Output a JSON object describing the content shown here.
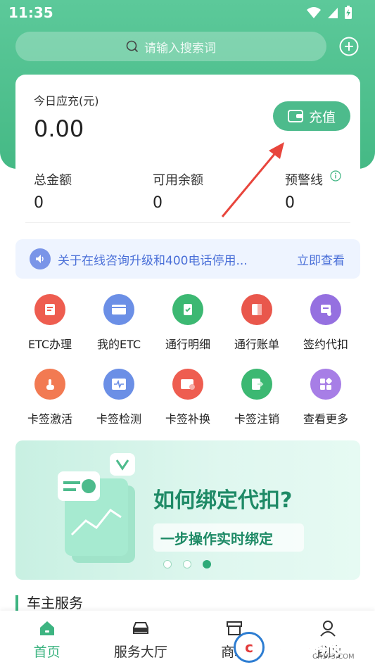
{
  "status": {
    "time": "11:35"
  },
  "search": {
    "placeholder": "请输入搜索词"
  },
  "card": {
    "today_label": "今日应充(元)",
    "today_value": "0.00",
    "charge_label": "充值",
    "stats": [
      {
        "label": "总金额",
        "value": "0"
      },
      {
        "label": "可用余额",
        "value": "0"
      },
      {
        "label": "预警线",
        "value": "0"
      }
    ]
  },
  "notice": {
    "text": "关于在线咨询升级和400电话停用...",
    "link": "立即查看"
  },
  "grid": [
    {
      "label": "ETC办理",
      "icon": "etc-apply-icon",
      "color": "#ee5d50"
    },
    {
      "label": "我的ETC",
      "icon": "etc-card-icon",
      "color": "#6b8fe6"
    },
    {
      "label": "通行明细",
      "icon": "pass-detail-icon",
      "color": "#3cb872"
    },
    {
      "label": "通行账单",
      "icon": "pass-bill-icon",
      "color": "#e9574c"
    },
    {
      "label": "签约代扣",
      "icon": "sign-withhold-icon",
      "color": "#9570e0"
    },
    {
      "label": "卡签激活",
      "icon": "activate-icon",
      "color": "#f27a52"
    },
    {
      "label": "卡签检测",
      "icon": "detect-icon",
      "color": "#6b8fe6"
    },
    {
      "label": "卡签补换",
      "icon": "replace-icon",
      "color": "#ee5d50"
    },
    {
      "label": "卡签注销",
      "icon": "cancel-icon",
      "color": "#3cb872"
    },
    {
      "label": "查看更多",
      "icon": "more-icon",
      "color": "#a77ee6"
    }
  ],
  "banner": {
    "title": "如何绑定代扣?",
    "subtitle": "一步操作实时绑定",
    "page_count": 3,
    "active_page": 3
  },
  "section": {
    "title": "车主服务"
  },
  "tabs": [
    {
      "label": "首页",
      "icon": "home-icon",
      "active": true
    },
    {
      "label": "服务大厅",
      "icon": "car-icon",
      "active": false
    },
    {
      "label": "商城",
      "icon": "shop-icon",
      "active": false
    },
    {
      "label": "我的",
      "icon": "user-icon",
      "active": false
    }
  ],
  "watermark": {
    "text": "西西软件园",
    "url": "CR173.COM"
  },
  "colors": {
    "brand": "#4dbb8c",
    "notice": "#4a6fd8"
  }
}
